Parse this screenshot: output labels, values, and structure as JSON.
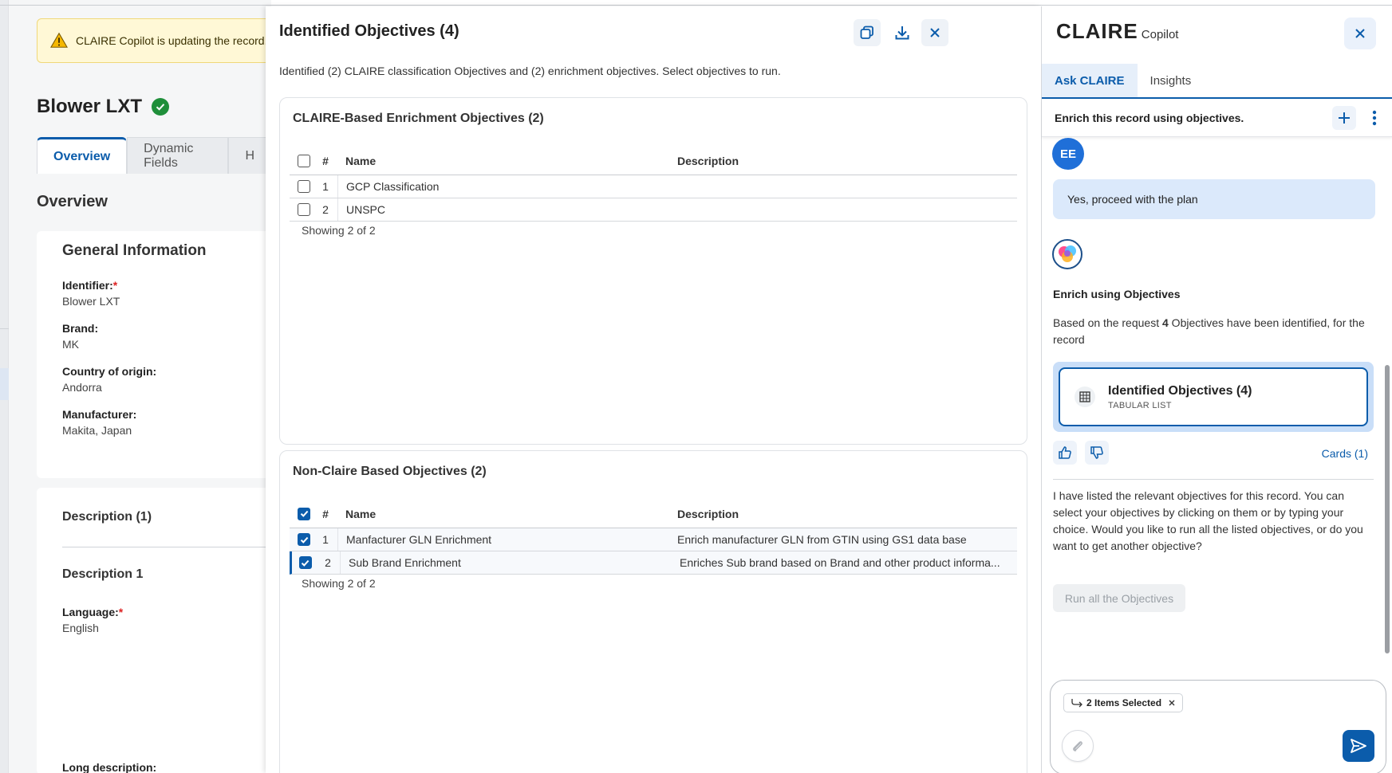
{
  "record_page": {
    "banner_text": "CLAIRE Copilot is updating the record.",
    "record_title": "Blower LXT",
    "tabs": [
      {
        "label": "Overview",
        "active": true
      },
      {
        "label": "Dynamic Fields",
        "active": false
      },
      {
        "label": "H",
        "active": false
      }
    ],
    "section_title": "Overview",
    "general_information": {
      "title": "General Information",
      "fields": [
        {
          "label": "Identifier:",
          "required": "*",
          "value": "Blower LXT"
        },
        {
          "label": "Brand:",
          "required": "",
          "value": "MK"
        },
        {
          "label": "Country of origin:",
          "required": "",
          "value": "Andorra"
        },
        {
          "label": "Manufacturer:",
          "required": "",
          "value": "Makita, Japan"
        }
      ]
    },
    "description_card": {
      "title": "Description (1)",
      "subtitle": "Description 1",
      "language_label": "Language:",
      "language_required": "*",
      "language_value": "English",
      "long_description_label": "Long description:"
    }
  },
  "modal": {
    "title": "Identified Objectives (4)",
    "description": "Identified (2) CLAIRE classification Objectives and (2) enrichment objectives. Select objectives to run.",
    "icons": [
      "copy-icon",
      "download-icon",
      "close-icon"
    ],
    "columns": {
      "num": "#",
      "name": "Name",
      "description": "Description"
    },
    "claire_section": {
      "title": "CLAIRE-Based Enrichment Objectives (2)",
      "header_checked": false,
      "rows": [
        {
          "num": "1",
          "name": "GCP Classification",
          "description": "",
          "checked": false
        },
        {
          "num": "2",
          "name": "UNSPC",
          "description": "",
          "checked": false
        }
      ],
      "showing": "Showing 2 of 2"
    },
    "non_claire_section": {
      "title": "Non-Claire Based Objectives (2)",
      "header_checked": true,
      "rows": [
        {
          "num": "1",
          "name": "Manfacturer GLN Enrichment",
          "description": "Enrich manufacturer GLN from GTIN using GS1 data base",
          "checked": true
        },
        {
          "num": "2",
          "name": "Sub Brand Enrichment",
          "description": "Enriches Sub brand based on Brand and other product informa...",
          "checked": true
        }
      ],
      "showing": "Showing 2 of 2"
    }
  },
  "copilot": {
    "brand_main": "CLAIRE",
    "brand_sub": "Copilot",
    "tabs": [
      {
        "label": "Ask CLAIRE",
        "active": true
      },
      {
        "label": "Insights",
        "active": false
      }
    ],
    "context_text": "Enrich this record using objectives.",
    "user_initials": "EE",
    "user_message": "Yes, proceed with the plan",
    "bot_heading": "Enrich using Objectives",
    "bot_text_pre": "Based on the request ",
    "bot_text_bold": "4",
    "bot_text_post": " Objectives have been identified, for the record",
    "objectives_card": {
      "title": "Identified Objectives (4)",
      "subtitle": "TABULAR LIST"
    },
    "cards_link": "Cards (1)",
    "bot_followup": "I have listed the relevant objectives for this record. You can select your objectives by clicking on them or by typing your choice. Would you like to run all the listed objectives, or do you want to get another objective?",
    "run_button": "Run all the Objectives",
    "chip_label": "2 Items Selected",
    "colors": {
      "accent": "#0b5cab",
      "user_bubble": "#dbe9fb",
      "banner": "#fff8d6"
    }
  }
}
